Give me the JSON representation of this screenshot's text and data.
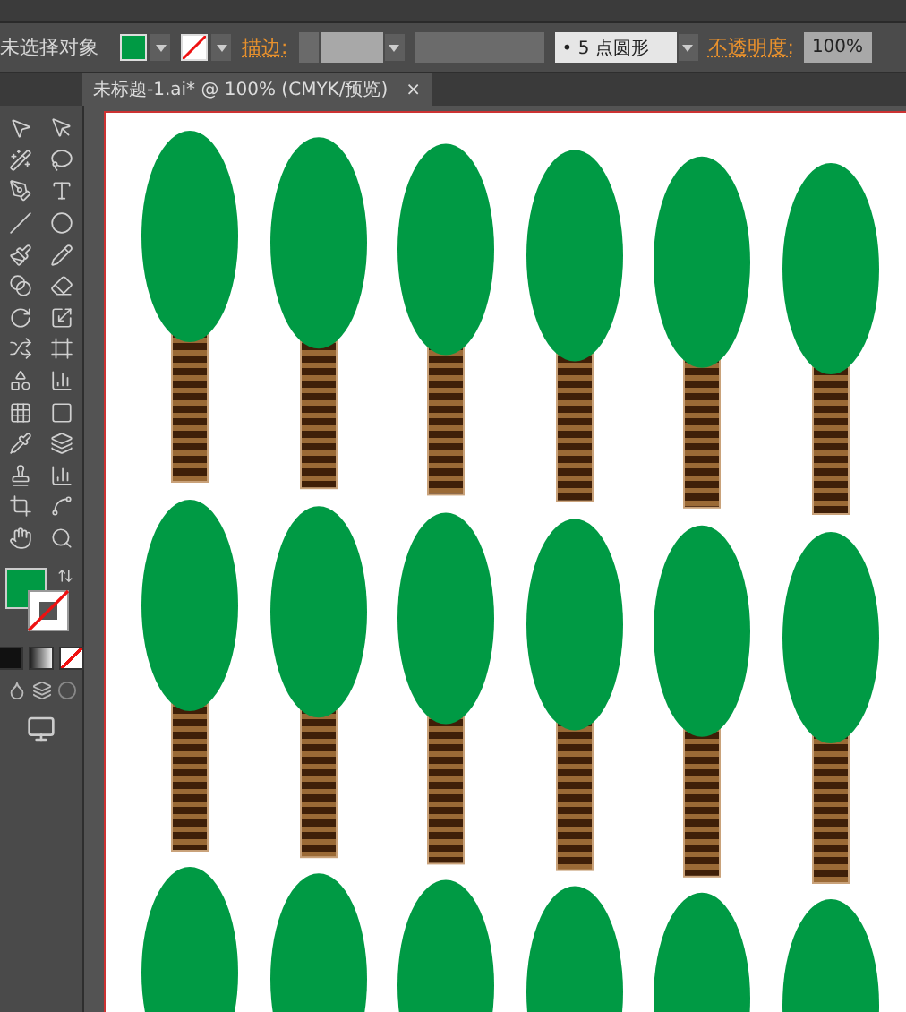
{
  "control_bar": {
    "selection": "未选择对象",
    "stroke_none": true,
    "stroke_label": "描边:",
    "brush": {
      "dot": "•",
      "text": "5 点圆形"
    },
    "opacity_label": "不透明度:",
    "opacity": "100%"
  },
  "document_tab": {
    "title": "未标题-1.ai* @ 100% (CMYK/预览)",
    "close": "×",
    "selected": true
  },
  "toolbar": {
    "stroke_none": true
  }
}
